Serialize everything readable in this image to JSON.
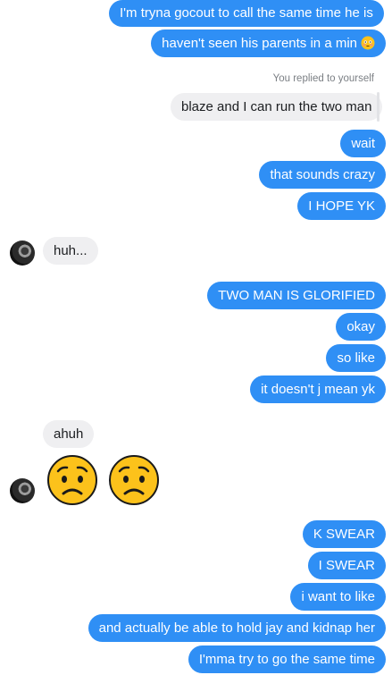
{
  "messages": {
    "m1": "I'm tryna gocout to call the same time he is",
    "m2": "haven't seen his parents in a min",
    "reply_note": "You replied to yourself",
    "m3": "blaze and I can run the two man",
    "m4": "wait",
    "m5": "that sounds crazy",
    "m6": "I HOPE YK",
    "m7": "huh...",
    "m8": "TWO MAN IS GLORIFIED",
    "m9": "okay",
    "m10": "so like",
    "m11": "it doesn't j mean yk",
    "m12": "ahuh",
    "m13": "K SWEAR",
    "m14": "I SWEAR",
    "m15": "i want to like",
    "m16": "and actually be able to hold jay and kidnap her",
    "m17": "I'mma try to go the same time"
  },
  "icons": {
    "emoji_m2": "flushed-face-icon",
    "emoji_a": "worried-face-icon",
    "emoji_b": "worried-face-icon"
  },
  "colors": {
    "outgoing": "#2f8ff5",
    "incoming": "#efeff1",
    "emoji_yellow": "#fcc21b"
  }
}
